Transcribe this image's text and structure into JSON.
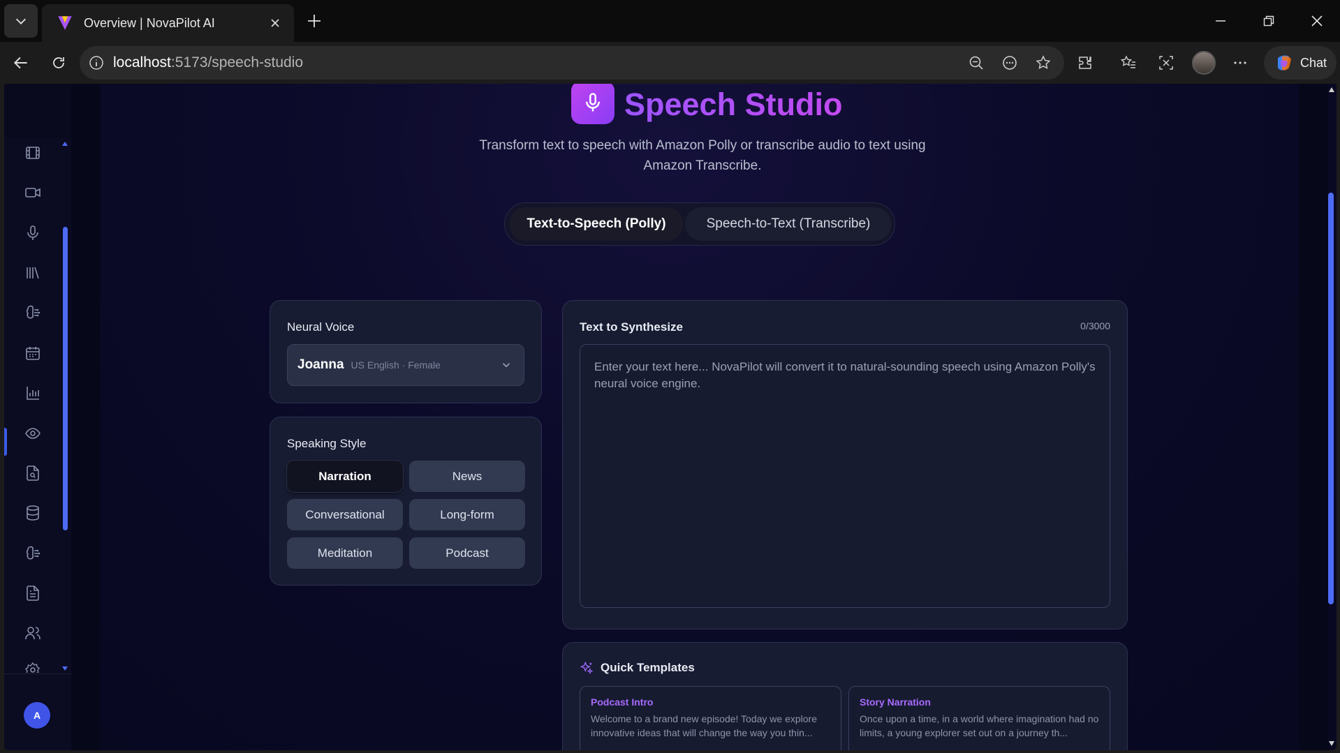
{
  "browser": {
    "tab_title": "Overview | NovaPilot AI",
    "url_host": "localhost",
    "url_path": ":5173/speech-studio",
    "chat_label": "Chat"
  },
  "header": {
    "title": "Speech Studio",
    "subtitle": "Transform text to speech with Amazon Polly or transcribe audio to text using Amazon Transcribe."
  },
  "modes": {
    "tts": "Text-to-Speech (Polly)",
    "stt": "Speech-to-Text (Transcribe)"
  },
  "voice": {
    "label": "Neural Voice",
    "name": "Joanna",
    "meta": "US English · Female"
  },
  "style": {
    "label": "Speaking Style",
    "options": [
      "Narration",
      "News",
      "Conversational",
      "Long-form",
      "Meditation",
      "Podcast"
    ],
    "selected": "Narration"
  },
  "synth": {
    "label": "Text to Synthesize",
    "counter": "0/3000",
    "placeholder": "Enter your text here... NovaPilot will convert it to natural-sounding speech using Amazon Polly's neural voice engine."
  },
  "templates": {
    "label": "Quick Templates",
    "items": [
      {
        "title": "Podcast Intro",
        "text": "Welcome to a brand new episode! Today we explore innovative ideas that will change the way you thin..."
      },
      {
        "title": "Story Narration",
        "text": "Once upon a time, in a world where imagination had no limits, a young explorer set out on a journey th..."
      }
    ]
  },
  "user": {
    "initial": "A"
  },
  "colors": {
    "accent": "#4d6bf5",
    "brand_purple": "#b74cf5",
    "template_title": "#a76bff"
  }
}
